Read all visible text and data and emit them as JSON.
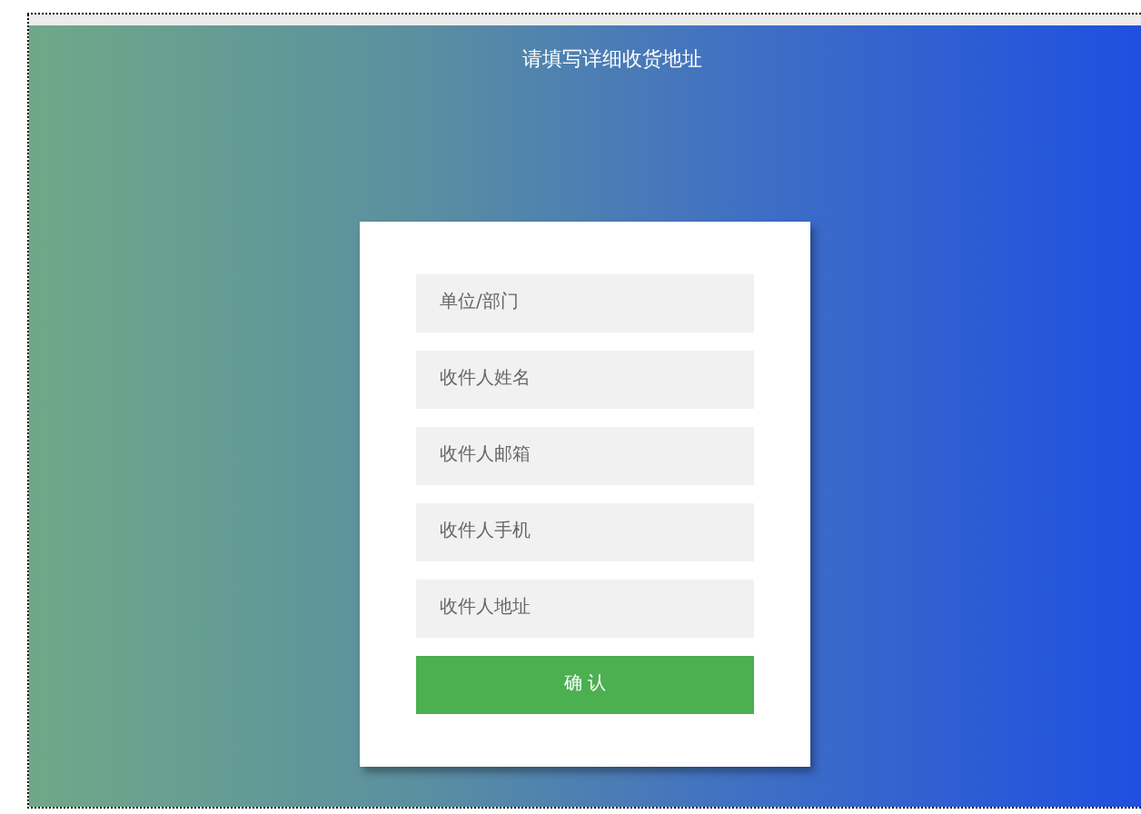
{
  "title": "请填写详细收货地址",
  "fields": [
    {
      "placeholder": "单位/部门"
    },
    {
      "placeholder": "收件人姓名"
    },
    {
      "placeholder": "收件人邮箱"
    },
    {
      "placeholder": "收件人手机"
    },
    {
      "placeholder": "收件人地址"
    }
  ],
  "button": "确 认"
}
